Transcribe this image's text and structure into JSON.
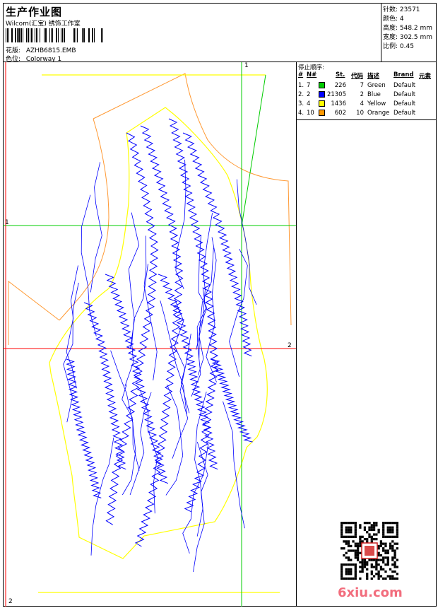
{
  "header": {
    "title": "生产作业图",
    "company": "Wilcom(汇宝) 绣饰工作室",
    "pattern_label": "花版:",
    "pattern_value": "AZHB6815.EMB",
    "colorway_label": "色位:",
    "colorway_value": "Colorway 1"
  },
  "stats": {
    "stitches": "针数: 23571",
    "colors": "颜色: 4",
    "height": "高度: 548.2 mm",
    "width": "宽度: 302.5 mm",
    "scale": "比例: 0.45"
  },
  "stop_sequence": {
    "caption": "停止顺序:",
    "headers": [
      "#",
      "N#",
      "St.",
      "代码",
      "描述",
      "Brand",
      "元素"
    ],
    "rows": [
      {
        "idx": "1.",
        "n": "7",
        "st": "226",
        "code": "7",
        "desc": "Green",
        "brand": "Default",
        "color": "#00cc00"
      },
      {
        "idx": "2.",
        "n": "2",
        "st": "21305",
        "code": "2",
        "desc": "Blue",
        "brand": "Default",
        "color": "#0000ff"
      },
      {
        "idx": "3.",
        "n": "4",
        "st": "1436",
        "code": "4",
        "desc": "Yellow",
        "brand": "Default",
        "color": "#ffff00"
      },
      {
        "idx": "4.",
        "n": "10",
        "st": "602",
        "code": "10",
        "desc": "Orange",
        "brand": "Default",
        "color": "#ff9900"
      }
    ]
  },
  "guides": {
    "v1_label": "1",
    "h1_label": "1",
    "h2_label": "2",
    "v2_label": "2"
  },
  "colors": {
    "guide_green": "#00cc00",
    "guide_red": "#ff0000",
    "outline_yellow": "#ffff00",
    "outline_orange": "#ff9933",
    "stitch_blue": "#0000ff"
  },
  "watermark": "6xiu.com"
}
